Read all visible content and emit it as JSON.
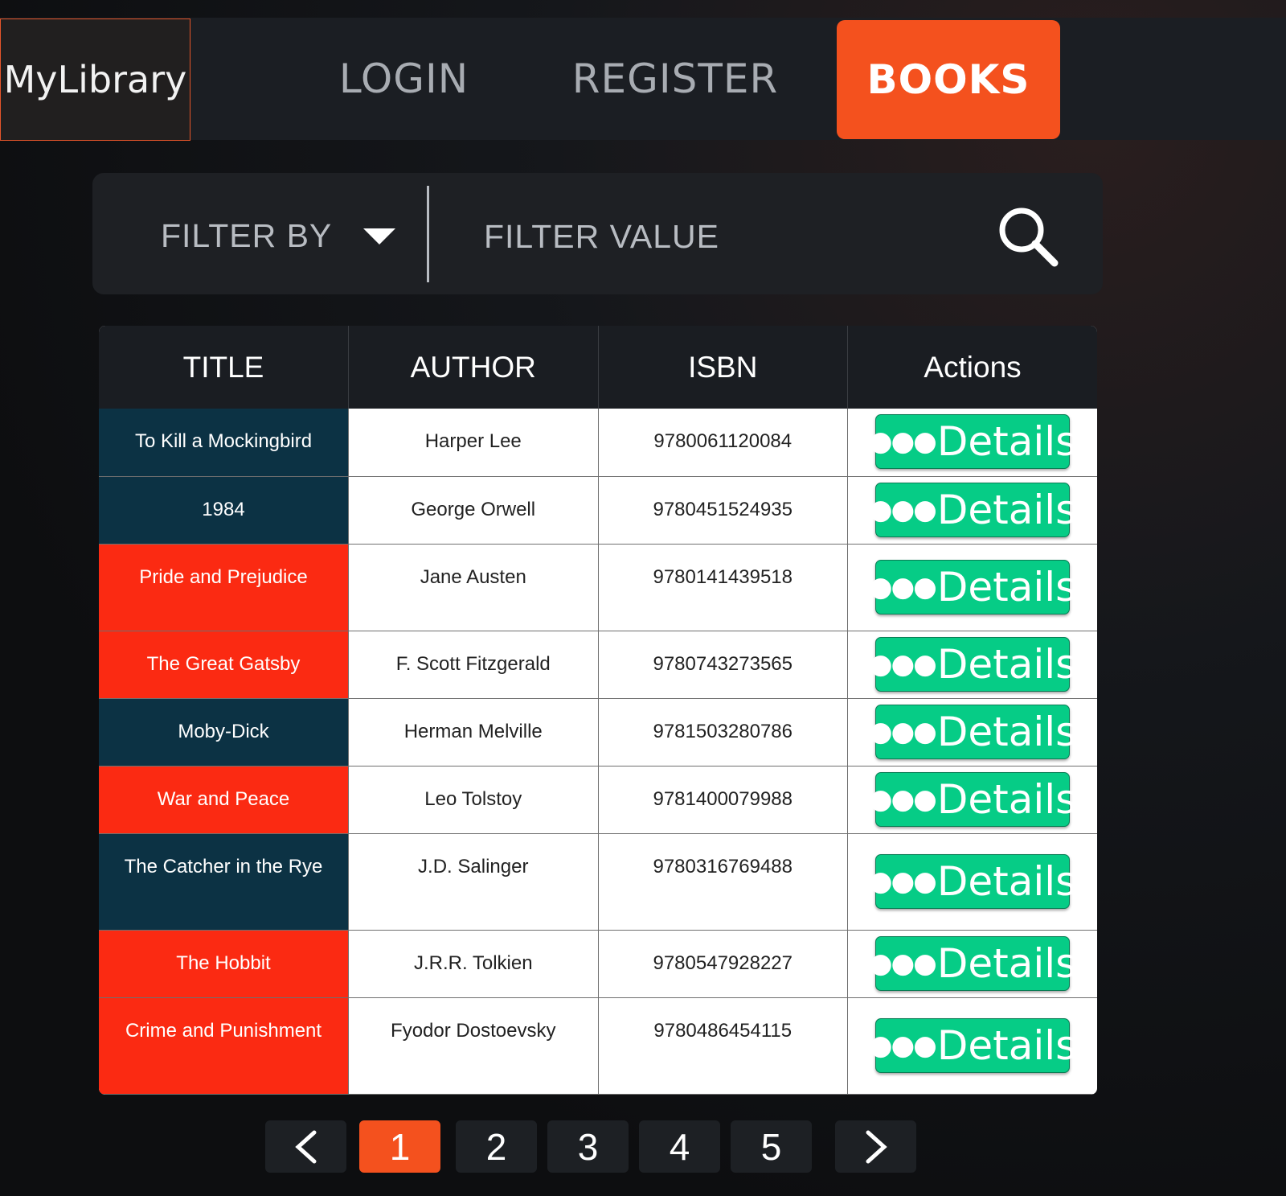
{
  "nav": {
    "brand": "MyLibrary",
    "login": "LOGIN",
    "register": "REGISTER",
    "books": "BOOKS",
    "active": "BOOKS"
  },
  "filter": {
    "filter_by_label": "FILTER BY",
    "value_placeholder": "FILTER VALUE",
    "search_icon": "search-icon"
  },
  "table": {
    "headers": [
      "TITLE",
      "AUTHOR",
      "ISBN",
      "Actions"
    ],
    "rows": [
      {
        "title": "To Kill a Mockingbird",
        "author": "Harper Lee",
        "isbn": "9780061120084",
        "action": "Details",
        "title_color": "#0c3244"
      },
      {
        "title": "1984",
        "author": "George Orwell",
        "isbn": "9780451524935",
        "action": "Details",
        "title_color": "#0c3244"
      },
      {
        "title": "Pride and Prejudice",
        "author": "Jane Austen",
        "isbn": "9780141439518",
        "action": "Details",
        "title_color": "#fb2a12"
      },
      {
        "title": "The Great Gatsby",
        "author": "F. Scott Fitzgerald",
        "isbn": "9780743273565",
        "action": "Details",
        "title_color": "#fb2a12"
      },
      {
        "title": "Moby-Dick",
        "author": "Herman Melville",
        "isbn": "9781503280786",
        "action": "Details",
        "title_color": "#0c3244"
      },
      {
        "title": "War and Peace",
        "author": "Leo Tolstoy",
        "isbn": "9781400079988",
        "action": "Details",
        "title_color": "#fb2a12"
      },
      {
        "title": "The Catcher in the Rye",
        "author": "J.D. Salinger",
        "isbn": "9780316769488",
        "action": "Details",
        "title_color": "#0c3244"
      },
      {
        "title": "The Hobbit",
        "author": "J.R.R. Tolkien",
        "isbn": "9780547928227",
        "action": "Details",
        "title_color": "#fb2a12"
      },
      {
        "title": "Crime and Punishment",
        "author": "Fyodor Dostoevsky",
        "isbn": "9780486454115",
        "action": "Details",
        "title_color": "#fb2a12"
      }
    ]
  },
  "pagination": {
    "prev": "<",
    "next": ">",
    "pages": [
      "1",
      "2",
      "3",
      "4",
      "5"
    ],
    "current": "1"
  },
  "colors": {
    "accent": "#f4511e",
    "details_button": "#06cc86",
    "title_dark": "#0c3244",
    "title_red": "#fb2a12"
  }
}
